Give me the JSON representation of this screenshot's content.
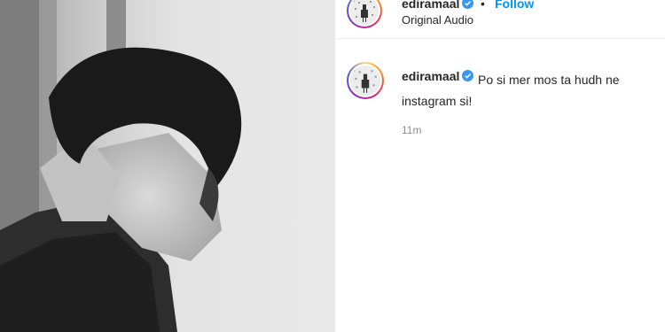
{
  "post": {
    "author": "ediramaal",
    "follow_label": "Follow",
    "separator": "•",
    "audio_label": "Original Audio",
    "more_icon": "more-horizontal-icon"
  },
  "caption": {
    "author": "ediramaal",
    "text": "Po si mer mos ta hudh ne instagram si!",
    "timestamp": "11m"
  },
  "colors": {
    "follow": "#0095f6",
    "verified": "#3897f0",
    "timestamp": "#8e8e8e"
  }
}
